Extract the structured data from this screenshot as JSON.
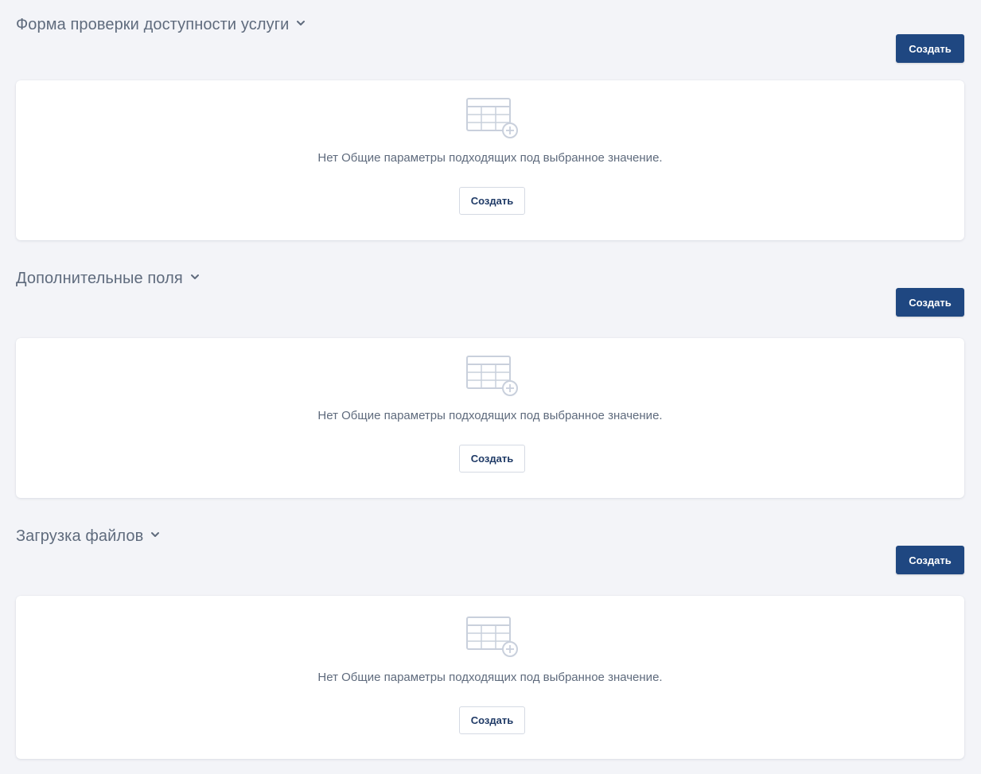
{
  "sections": [
    {
      "title": "Форма проверки доступности услуги",
      "create_label": "Создать",
      "empty_text": "Нет Общие параметры подходящих под выбранное значение.",
      "empty_create_label": "Создать"
    },
    {
      "title": "Дополнительные поля",
      "create_label": "Создать",
      "empty_text": "Нет Общие параметры подходящих под выбранное значение.",
      "empty_create_label": "Создать"
    },
    {
      "title": "Загрузка файлов",
      "create_label": "Создать",
      "empty_text": "Нет Общие параметры подходящих под выбранное значение.",
      "empty_create_label": "Создать"
    }
  ],
  "icons": {
    "collapse": "chevron-down-icon",
    "empty_state": "table-add-icon"
  },
  "colors": {
    "background": "#f3f4f8",
    "primary_button": "#1f4781",
    "text_muted": "#5f6b7d",
    "icon_stroke": "#c9d0dc"
  }
}
